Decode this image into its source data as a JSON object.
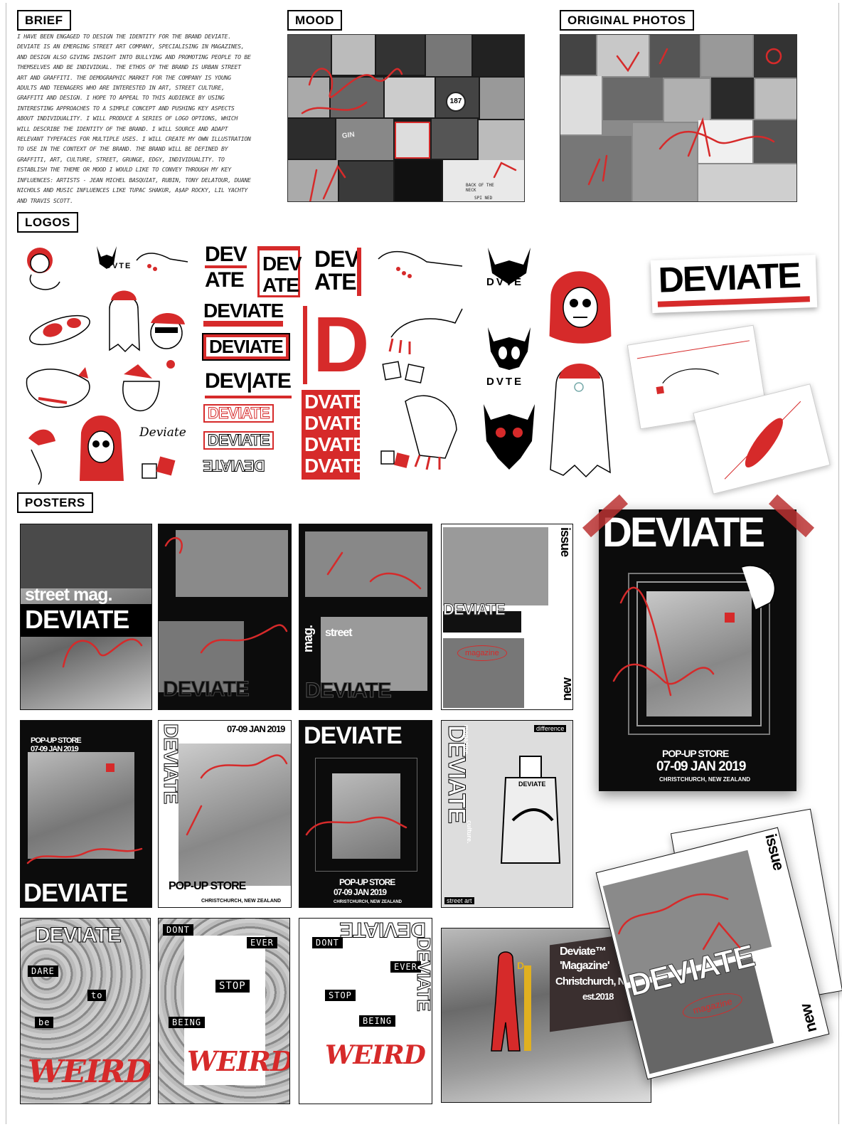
{
  "sections": {
    "brief": "BRIEF",
    "mood": "MOOD",
    "original_photos": "ORIGINAL PHOTOS",
    "logos": "LOGOS",
    "posters": "POSTERS"
  },
  "brief_text": "I have been engaged to design the identity for the brand Deviate. Deviate is an emerging street art company, specialising in magazines, and design also giving insight into bullying and promoting people to be themselves and be individual. The ethos of the brand is urban street art and graffiti. The demographic market for the company is young adults and teenagers who are interested in art, street culture, graffiti and design. I hope to appeal to this audience by using interesting approaches to a simple concept and pushing key aspects about individuality. I will produce a series of logo options, which will describe the identity of the brand. I will source and adapt relevant typefaces for multiple uses. I will create my own illustration to use in the context of the brand. The brand will be defined by graffiti, art, culture, street, grunge, edgy, individuality. To establish the theme or mood I would like to convey through my key influences: artists - Jean Michel Basquiat, Rubin, Tony Delatour, Duane Nichols and music influences like Tupac Shakur, A$AP Rocky, Lil Yachty and Travis Scott.",
  "mood_labels": {
    "sign": "187",
    "back": "BACK OF THE NECK",
    "spine": "SPI NED",
    "gin": "GIN"
  },
  "logos": {
    "dvte": "DVTE",
    "dev": "DEV",
    "ate": "ATE",
    "deviate": "DEVIATE",
    "dev_ate_split": "DEV|ATE",
    "dvate": "DVATE",
    "d": "D",
    "script": "Deviate",
    "sticker_deviate": "DEVIATE",
    "ghost_badge": "DEVIATE"
  },
  "posters": {
    "street_mag": "street mag.",
    "deviate": "DEVIATE",
    "mag": "mag.",
    "street": "street",
    "issue": "issue",
    "new": "new",
    "magazine": "magazine",
    "popup": "POP-UP STORE",
    "dates": "07-09 JAN 2019",
    "location": "CHRISTCHURCH, NEW ZEALAND",
    "culture": "culture.",
    "magazine_dot": "magazine.",
    "street_art": "street art",
    "difference": "difference",
    "can_label": "DEVIATE",
    "dare": "DARE",
    "to": "to",
    "be": "be",
    "weird": "WEIRD",
    "dont": "DONT",
    "ever": "EVER",
    "stop": "STOP",
    "being": "BEING",
    "billboard_l1": "Deviate™",
    "billboard_l2": "'Magazine'",
    "billboard_l3": "Christchurch, NZ",
    "billboard_l4": "est.2018",
    "devil_sign": "D"
  },
  "colors": {
    "accent": "#d62a2a",
    "ink": "#0c0c0c",
    "paper": "#ffffff"
  }
}
